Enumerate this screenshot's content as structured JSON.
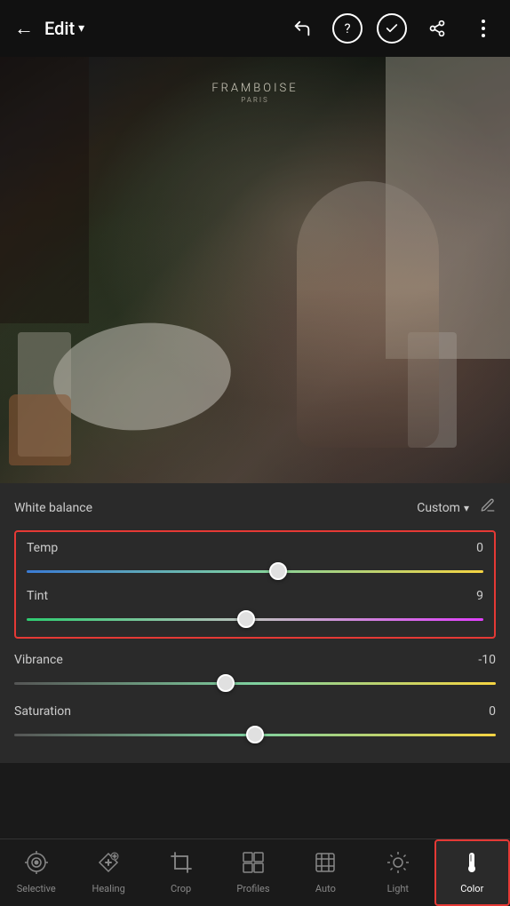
{
  "header": {
    "back_label": "←",
    "title": "Edit",
    "title_chevron": "▾",
    "undo_icon": "undo",
    "help_icon": "help",
    "done_icon": "done",
    "share_icon": "share",
    "more_icon": "more"
  },
  "image": {
    "sign_text": "FRAMBOISE",
    "sign_sub": "PARIS"
  },
  "controls": {
    "white_balance_label": "White balance",
    "white_balance_preset": "Custom",
    "sliders": [
      {
        "name": "Temp",
        "value": "0",
        "thumb_pct": 55,
        "track_type": "temp"
      },
      {
        "name": "Tint",
        "value": "9",
        "thumb_pct": 48,
        "track_type": "tint"
      }
    ],
    "extra_sliders": [
      {
        "name": "Vibrance",
        "value": "-10",
        "thumb_pct": 44,
        "track_type": "vibrance"
      },
      {
        "name": "Saturation",
        "value": "0",
        "thumb_pct": 50,
        "track_type": "sat"
      }
    ]
  },
  "bottom_nav": {
    "items": [
      {
        "id": "selective",
        "label": "Selective",
        "icon": "✦"
      },
      {
        "id": "healing",
        "label": "Healing",
        "icon": "✦"
      },
      {
        "id": "crop",
        "label": "Crop",
        "icon": "⊡"
      },
      {
        "id": "profiles",
        "label": "Profiles",
        "icon": "▦"
      },
      {
        "id": "auto",
        "label": "Auto",
        "icon": "⊞"
      },
      {
        "id": "light",
        "label": "Light",
        "icon": "☼"
      },
      {
        "id": "color",
        "label": "Color",
        "icon": "🌡",
        "active": true
      }
    ]
  },
  "colors": {
    "accent": "#e53935",
    "active_text": "#ffffff",
    "inactive_text": "#888888"
  }
}
